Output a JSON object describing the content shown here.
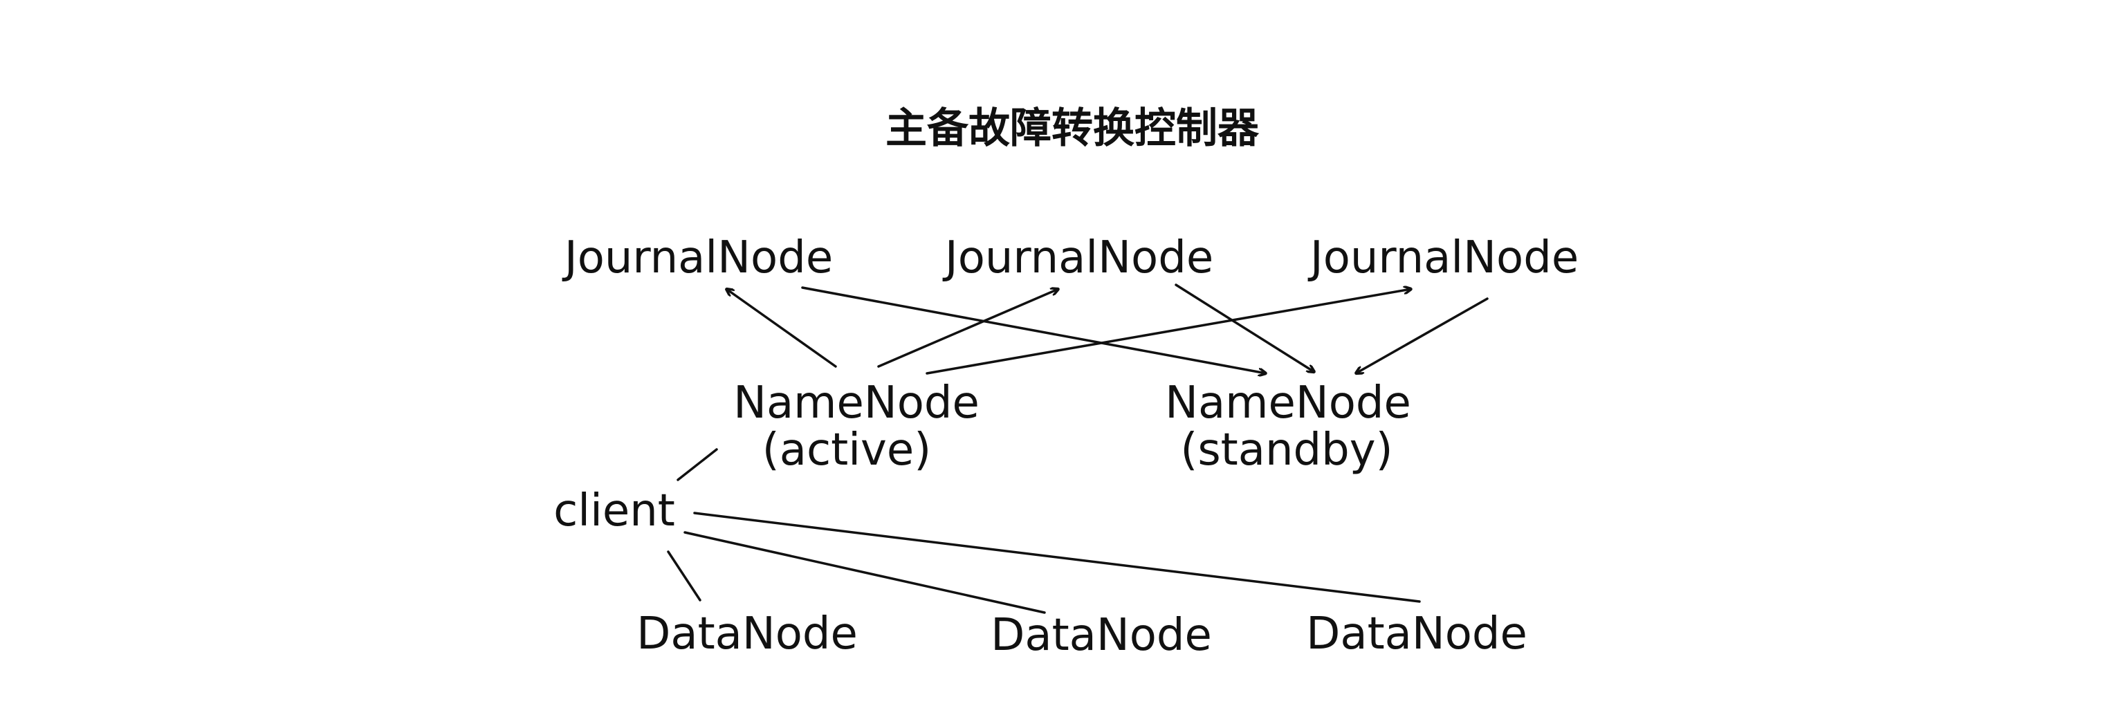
{
  "title": "主备故障转换控制器",
  "nodes": {
    "journal_1": "JournalNode",
    "journal_2": "JournalNode",
    "journal_3": "JournalNode",
    "namenode_active": "NameNode",
    "namenode_active_role": "(active)",
    "namenode_standby": "NameNode",
    "namenode_standby_role": "(standby)",
    "client": "client",
    "datanode_1": "DataNode",
    "datanode_2": "DataNode",
    "datanode_3": "DataNode"
  },
  "edges": [
    {
      "from": "namenode_active",
      "to": "journal_1",
      "arrow": true
    },
    {
      "from": "namenode_active",
      "to": "journal_2",
      "arrow": true
    },
    {
      "from": "namenode_active",
      "to": "journal_3",
      "arrow": true
    },
    {
      "from": "journal_1",
      "to": "namenode_standby",
      "arrow": true
    },
    {
      "from": "journal_2",
      "to": "namenode_standby",
      "arrow": true
    },
    {
      "from": "journal_3",
      "to": "namenode_standby",
      "arrow": true
    },
    {
      "from": "client",
      "to": "namenode_active",
      "arrow": false
    },
    {
      "from": "client",
      "to": "datanode_1",
      "arrow": false
    },
    {
      "from": "client",
      "to": "datanode_2",
      "arrow": false
    },
    {
      "from": "client",
      "to": "datanode_3",
      "arrow": false
    }
  ]
}
